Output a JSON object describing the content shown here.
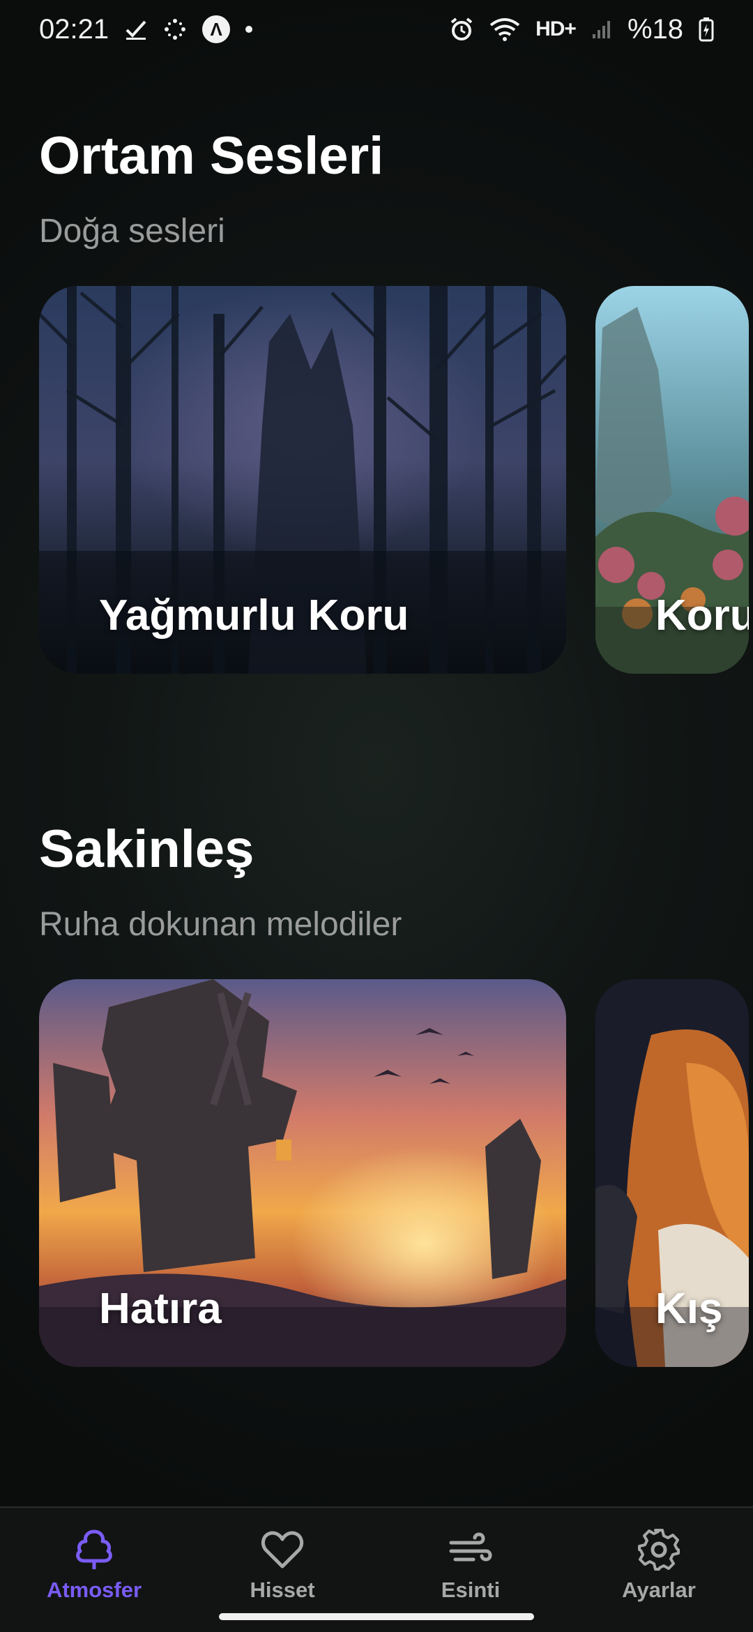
{
  "status_bar": {
    "time": "02:21",
    "network": "HD+",
    "battery": "%18",
    "icons": [
      "check-icon",
      "sparkle-icon",
      "app-a-icon",
      "dot-icon",
      "alarm-icon",
      "wifi-icon",
      "signal-icon",
      "battery-charging-icon"
    ]
  },
  "sections": [
    {
      "title": "Ortam Sesleri",
      "subtitle": "Doğa sesleri",
      "cards": [
        {
          "label": "Yağmurlu Koru"
        },
        {
          "label": "Koru"
        }
      ]
    },
    {
      "title": "Sakinleş",
      "subtitle": "Ruha dokunan melodiler",
      "cards": [
        {
          "label": "Hatıra"
        },
        {
          "label": "Kış"
        }
      ]
    }
  ],
  "bottom_nav": {
    "active": "Atmosfer",
    "items": [
      {
        "label": "Atmosfer",
        "icon": "tree-icon"
      },
      {
        "label": "Hisset",
        "icon": "heart-icon"
      },
      {
        "label": "Esinti",
        "icon": "wind-icon"
      },
      {
        "label": "Ayarlar",
        "icon": "gear-icon"
      }
    ]
  },
  "colors": {
    "accent": "#7a5cf5",
    "inactive": "#a7a9a9",
    "background": "#0b0d0d"
  }
}
